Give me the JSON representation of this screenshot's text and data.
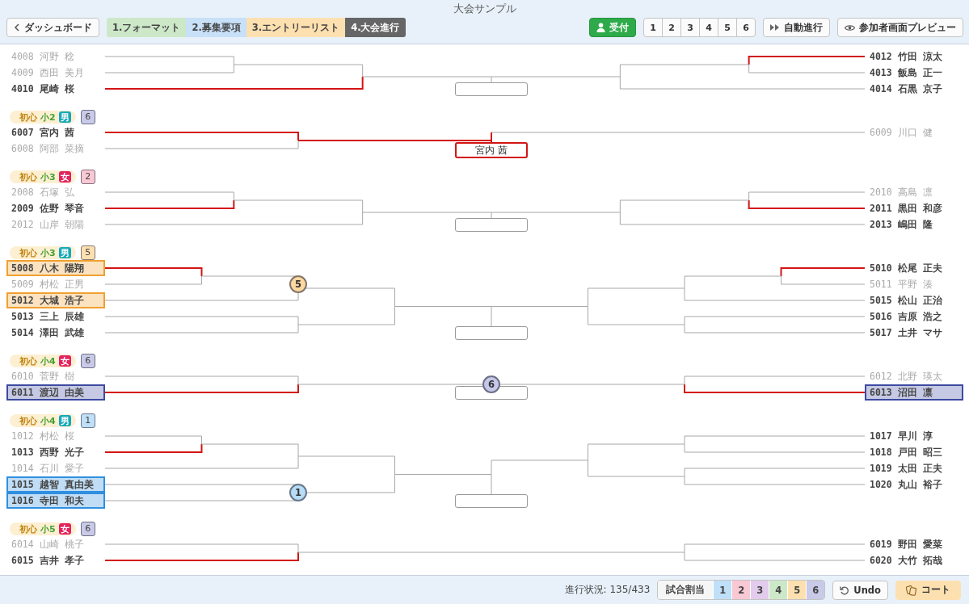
{
  "window": {
    "title": "大会サンプル"
  },
  "toolbar": {
    "back": "ダッシュボード",
    "steps": [
      {
        "label": "1.フォーマット",
        "color": "#cde8c8",
        "selected": false
      },
      {
        "label": "2.募集要項",
        "color": "#c8e0f8",
        "selected": false
      },
      {
        "label": "3.エントリーリスト",
        "color": "#fde0b0",
        "selected": false
      },
      {
        "label": "4.大会進行",
        "color": "#666666",
        "selected": true
      }
    ],
    "reception": "受付",
    "courts": [
      "1",
      "2",
      "3",
      "4",
      "5",
      "6"
    ],
    "auto": "自動進行",
    "preview": "参加者画面プレビュー"
  },
  "groups": [
    {
      "left": [
        {
          "id": "4008",
          "name": "河野 稔",
          "eliminated": true,
          "advanced": false
        },
        {
          "id": "4009",
          "name": "西田 美月",
          "eliminated": true,
          "advanced": false
        },
        {
          "id": "4010",
          "name": "尾崎 桜",
          "eliminated": false,
          "advanced": true
        }
      ],
      "right": [
        {
          "id": "4012",
          "name": "竹田 涼太",
          "eliminated": false,
          "advanced": true
        },
        {
          "id": "4013",
          "name": "飯島 正一",
          "eliminated": false,
          "advanced": false
        },
        {
          "id": "4014",
          "name": "石黒 京子",
          "eliminated": false,
          "advanced": false
        }
      ],
      "final": {
        "decided": false
      }
    },
    {
      "header": {
        "level": "初心",
        "grade": "小2",
        "gender": "男",
        "kind": "male",
        "court": "6",
        "color": "#c8cae8"
      },
      "left": [
        {
          "id": "6007",
          "name": "宮内 茜",
          "eliminated": false,
          "advanced": true
        },
        {
          "id": "6008",
          "name": "阿部 菜摘",
          "eliminated": true,
          "advanced": false
        }
      ],
      "right": [
        {
          "id": "6009",
          "name": "川口 健",
          "eliminated": true,
          "advanced": false
        }
      ],
      "final": {
        "decided": true,
        "winner": "宮内 茜"
      }
    },
    {
      "header": {
        "level": "初心",
        "grade": "小3",
        "gender": "女",
        "kind": "female",
        "court": "2",
        "color": "#f8c8d4"
      },
      "left": [
        {
          "id": "2008",
          "name": "石塚 弘",
          "eliminated": true,
          "advanced": false
        },
        {
          "id": "2009",
          "name": "佐野 琴音",
          "eliminated": false,
          "advanced": true
        },
        {
          "id": "2012",
          "name": "山岸 朝陽",
          "eliminated": true,
          "advanced": false
        }
      ],
      "right": [
        {
          "id": "2010",
          "name": "高島 凛",
          "eliminated": true,
          "advanced": false
        },
        {
          "id": "2011",
          "name": "黒田 和彦",
          "eliminated": false,
          "advanced": true
        },
        {
          "id": "2013",
          "name": "嶋田 隆",
          "eliminated": false,
          "advanced": false
        }
      ],
      "final": {
        "decided": false
      }
    },
    {
      "header": {
        "level": "初心",
        "grade": "小3",
        "gender": "男",
        "kind": "male",
        "court": "5",
        "color": "#fde0b0"
      },
      "left": [
        {
          "id": "5008",
          "name": "八木 陽翔",
          "eliminated": false,
          "advanced": true,
          "color": "#f0a030"
        },
        {
          "id": "5009",
          "name": "村松 正男",
          "eliminated": true,
          "advanced": false
        },
        {
          "id": "5012",
          "name": "大城 浩子",
          "eliminated": false,
          "advanced": false,
          "color": "#f0a030"
        },
        {
          "id": "5013",
          "name": "三上 辰雄",
          "eliminated": false,
          "advanced": false
        },
        {
          "id": "5014",
          "name": "澤田 武雄",
          "eliminated": false,
          "advanced": false
        }
      ],
      "right": [
        {
          "id": "5010",
          "name": "松尾 正夫",
          "eliminated": false,
          "advanced": true
        },
        {
          "id": "5011",
          "name": "平野 湊",
          "eliminated": true,
          "advanced": false
        },
        {
          "id": "5015",
          "name": "松山 正治",
          "eliminated": false,
          "advanced": false
        },
        {
          "id": "5016",
          "name": "吉原 浩之",
          "eliminated": false,
          "advanced": false
        },
        {
          "id": "5017",
          "name": "土井 マサ",
          "eliminated": false,
          "advanced": false
        }
      ],
      "marker": {
        "label": "5",
        "color": "#fdd9a0",
        "kind": "left"
      },
      "final": {
        "decided": false
      }
    },
    {
      "header": {
        "level": "初心",
        "grade": "小4",
        "gender": "女",
        "kind": "female",
        "court": "6",
        "color": "#c8cae8"
      },
      "left": [
        {
          "id": "6010",
          "name": "菅野 樹",
          "eliminated": true,
          "advanced": false
        },
        {
          "id": "6011",
          "name": "渡辺 由美",
          "eliminated": false,
          "advanced": true,
          "color": "#3d4aa0"
        }
      ],
      "right": [
        {
          "id": "6012",
          "name": "北野 瑛太",
          "eliminated": true,
          "advanced": false
        },
        {
          "id": "6013",
          "name": "沼田 凛",
          "eliminated": false,
          "advanced": true,
          "color": "#3d4aa0"
        }
      ],
      "marker": {
        "label": "6",
        "color": "#c5c8e8",
        "kind": "center"
      },
      "final": {
        "decided": false
      }
    },
    {
      "header": {
        "level": "初心",
        "grade": "小4",
        "gender": "男",
        "kind": "male",
        "court": "1",
        "color": "#bfe0f8"
      },
      "left": [
        {
          "id": "1012",
          "name": "村松 桜",
          "eliminated": true,
          "advanced": false
        },
        {
          "id": "1013",
          "name": "西野 光子",
          "eliminated": false,
          "advanced": true
        },
        {
          "id": "1014",
          "name": "石川 愛子",
          "eliminated": true,
          "advanced": false
        },
        {
          "id": "1015",
          "name": "越智 真由美",
          "eliminated": false,
          "advanced": false,
          "color": "#2f8fe0"
        },
        {
          "id": "1016",
          "name": "寺田 和夫",
          "eliminated": false,
          "advanced": false,
          "color": "#2f8fe0"
        }
      ],
      "right": [
        {
          "id": "1017",
          "name": "早川 淳",
          "eliminated": false,
          "advanced": false
        },
        {
          "id": "1018",
          "name": "戸田 昭三",
          "eliminated": false,
          "advanced": false
        },
        {
          "id": "1019",
          "name": "太田 正夫",
          "eliminated": false,
          "advanced": false
        },
        {
          "id": "1020",
          "name": "丸山 裕子",
          "eliminated": false,
          "advanced": false
        }
      ],
      "marker": {
        "label": "1",
        "color": "#b8dcf6",
        "kind": "left"
      },
      "final": {
        "decided": false
      }
    },
    {
      "header": {
        "level": "初心",
        "grade": "小5",
        "gender": "女",
        "kind": "female",
        "court": "6",
        "color": "#c8cae8"
      },
      "left": [
        {
          "id": "6014",
          "name": "山崎 桃子",
          "eliminated": true,
          "advanced": false
        },
        {
          "id": "6015",
          "name": "吉井 孝子",
          "eliminated": false,
          "advanced": true
        }
      ],
      "right": [
        {
          "id": "6019",
          "name": "野田 愛菜",
          "eliminated": false,
          "advanced": false
        },
        {
          "id": "6020",
          "name": "大竹 拓哉",
          "eliminated": false,
          "advanced": false
        }
      ]
    }
  ],
  "footer": {
    "progress": "進行状況: 135/433",
    "assign": "試合割当",
    "courts": [
      {
        "label": "1",
        "color": "#bfe0f8"
      },
      {
        "label": "2",
        "color": "#f8c8d4"
      },
      {
        "label": "3",
        "color": "#e2cbec"
      },
      {
        "label": "4",
        "color": "#cde8c8"
      },
      {
        "label": "5",
        "color": "#fde0b0"
      },
      {
        "label": "6",
        "color": "#c8cae8"
      }
    ],
    "undo": "Undo",
    "court": "コート"
  }
}
